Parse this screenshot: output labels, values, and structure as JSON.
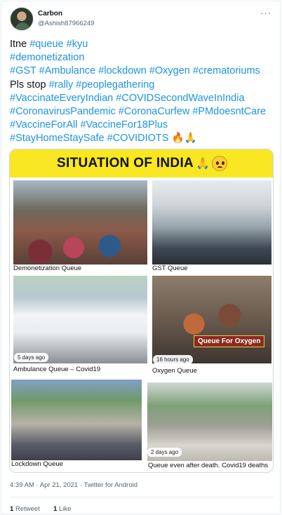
{
  "tweet": {
    "author": {
      "name": "Carbon",
      "handle": "@Ashish87966249"
    },
    "more_glyph": "···",
    "lines": [
      [
        {
          "t": "Itne ",
          "tag": false
        },
        {
          "t": "#queue",
          "tag": true
        },
        {
          "t": " ",
          "tag": false
        },
        {
          "t": "#kyu",
          "tag": true
        }
      ],
      [
        {
          "t": "#demonetization",
          "tag": true
        }
      ],
      [
        {
          "t": "#GST",
          "tag": true
        },
        {
          "t": " ",
          "tag": false
        },
        {
          "t": "#Ambulance",
          "tag": true
        },
        {
          "t": " ",
          "tag": false
        },
        {
          "t": "#lockdown",
          "tag": true
        },
        {
          "t": " ",
          "tag": false
        },
        {
          "t": "#Oxygen",
          "tag": true
        },
        {
          "t": " ",
          "tag": false
        },
        {
          "t": "#crematoriums",
          "tag": true
        }
      ],
      [
        {
          "t": "Pls stop ",
          "tag": false
        },
        {
          "t": "#rally",
          "tag": true
        },
        {
          "t": " ",
          "tag": false
        },
        {
          "t": "#peoplegathering",
          "tag": true
        }
      ],
      [
        {
          "t": "#VaccinateEveryIndian",
          "tag": true
        },
        {
          "t": " ",
          "tag": false
        },
        {
          "t": "#COVIDSecondWaveInIndia",
          "tag": true
        }
      ],
      [
        {
          "t": "#CoronavirusPandemic",
          "tag": true
        },
        {
          "t": " ",
          "tag": false
        },
        {
          "t": "#CoronaCurfew",
          "tag": true
        },
        {
          "t": " ",
          "tag": false
        },
        {
          "t": "#PMdoesntCare",
          "tag": true
        }
      ],
      [
        {
          "t": "#VaccineForAll",
          "tag": true
        },
        {
          "t": " ",
          "tag": false
        },
        {
          "t": "#VaccineFor18Plus",
          "tag": true
        }
      ],
      [
        {
          "t": "#StayHomeStaySafe",
          "tag": true
        },
        {
          "t": " ",
          "tag": false
        },
        {
          "t": "#COVIDIOTS",
          "tag": true
        },
        {
          "t": " 🔥🙏",
          "tag": false
        }
      ]
    ],
    "timestamp": "4:39 AM · Apr 21, 2021 · Twitter for Android",
    "stats": {
      "retweets": "1",
      "retweets_label": "Retweet",
      "likes": "1",
      "likes_label": "Like"
    }
  },
  "media": {
    "banner_title": "SITUATION OF INDIA",
    "banner_hands": "🙏",
    "oxygen_sign": "Queue For Oxygen",
    "panels": [
      {
        "caption": "Demonetization Queue"
      },
      {
        "caption": "GST Queue"
      },
      {
        "caption": "Ambulance Queue – Covid19",
        "badge": "5 days ago"
      },
      {
        "caption": "Oxygen Queue",
        "badge": "16 hours ago"
      },
      {
        "caption": "Lockdown Queue"
      },
      {
        "caption": "Queue even after death. Covid19 deaths",
        "badge": "2 days ago"
      }
    ]
  },
  "colors": {
    "hashtag": "#1b95e0",
    "banner": "#f8e722",
    "muted": "#536471"
  }
}
